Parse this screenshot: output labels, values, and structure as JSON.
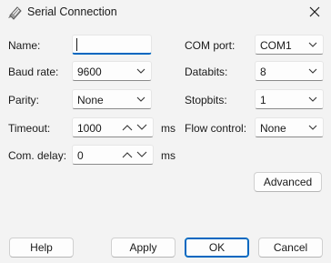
{
  "window": {
    "title": "Serial Connection",
    "icon": "serial-connection-icon"
  },
  "fields": {
    "name": {
      "label": "Name:",
      "value": ""
    },
    "baud_rate": {
      "label": "Baud rate:",
      "value": "9600"
    },
    "parity": {
      "label": "Parity:",
      "value": "None"
    },
    "timeout": {
      "label": "Timeout:",
      "value": "1000",
      "unit": "ms"
    },
    "com_delay": {
      "label": "Com. delay:",
      "value": "0",
      "unit": "ms"
    },
    "com_port": {
      "label": "COM port:",
      "value": "COM1"
    },
    "databits": {
      "label": "Databits:",
      "value": "8"
    },
    "stopbits": {
      "label": "Stopbits:",
      "value": "1"
    },
    "flow_control": {
      "label": "Flow control:",
      "value": "None"
    }
  },
  "buttons": {
    "advanced": "Advanced",
    "help": "Help",
    "apply": "Apply",
    "ok": "OK",
    "cancel": "Cancel"
  },
  "colors": {
    "accent": "#0067c0",
    "background": "#f3f3f3"
  }
}
